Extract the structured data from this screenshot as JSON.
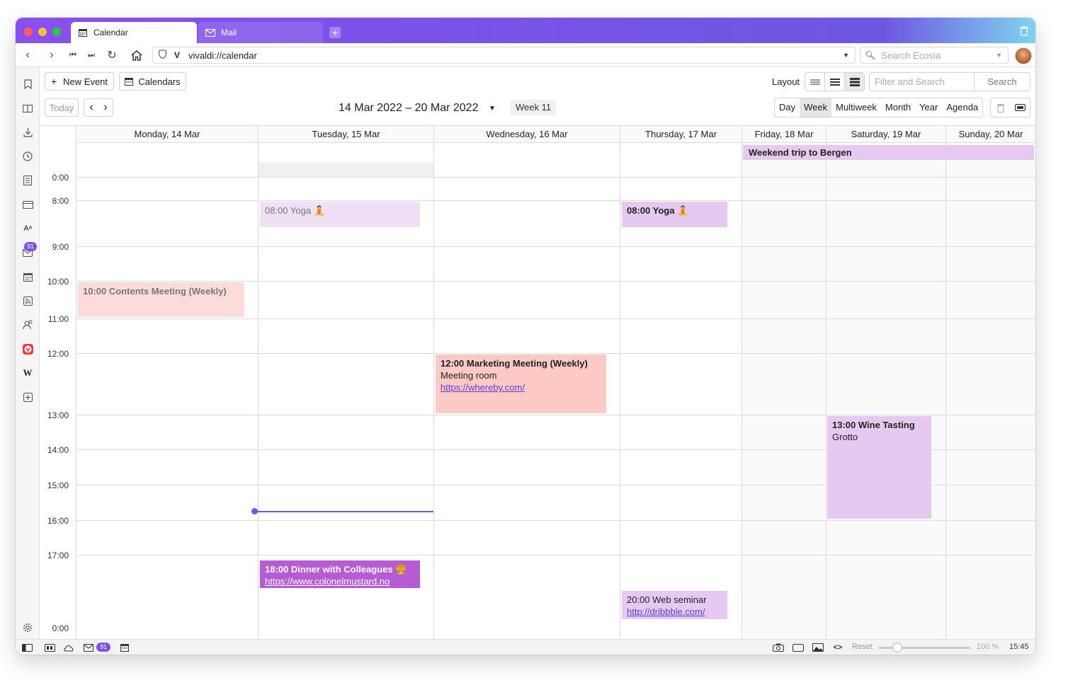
{
  "tabs": [
    {
      "label": "Calendar",
      "icon": "calendar-icon",
      "active": true
    },
    {
      "label": "Mail",
      "icon": "mail-icon",
      "active": false
    }
  ],
  "address": {
    "url": "vivaldi://calendar",
    "search_placeholder": "Search Ecosia"
  },
  "sidebar": {
    "icons": [
      "bookmark-icon",
      "reading-list-icon",
      "downloads-icon",
      "history-icon",
      "notes-icon",
      "window-panel-icon",
      "translate-icon",
      "mail-icon",
      "calendar-icon",
      "feeds-icon",
      "contacts-icon",
      "vivaldi-icon",
      "wikipedia-icon",
      "add-panel-icon",
      "settings-icon"
    ],
    "mail_count": "91"
  },
  "toolbar": {
    "new_event": "New Event",
    "calendars": "Calendars",
    "today": "Today",
    "date_range": "14 Mar 2022 – 20 Mar 2022",
    "week": "Week 11",
    "layout_label": "Layout",
    "filter_placeholder": "Filter and Search",
    "search_button": "Search",
    "views": [
      "Day",
      "Week",
      "Multiweek",
      "Month",
      "Year",
      "Agenda"
    ],
    "selected_view": "Week"
  },
  "days": [
    "Monday, 14 Mar",
    "Tuesday, 15 Mar",
    "Wednesday, 16 Mar",
    "Thursday, 17 Mar",
    "Friday, 18 Mar",
    "Saturday, 19 Mar",
    "Sunday, 20 Mar"
  ],
  "times": [
    "0:00",
    "8:00",
    "9:00",
    "10:00",
    "11:00",
    "12:00",
    "13:00",
    "14:00",
    "15:00",
    "16:00",
    "17:00",
    "0:00"
  ],
  "all_day_event": "Weekend trip to Bergen",
  "events": {
    "yoga_tue": "08:00 Yoga 🧘",
    "yoga_thu": "08:00 Yoga 🧘",
    "contents": "10:00 Contents Meeting (Weekly)",
    "marketing_title": "12:00 Marketing Meeting (Weekly)",
    "marketing_location": "Meeting room",
    "marketing_link": "https://whereby.com/",
    "wine_title": "13:00 Wine Tasting",
    "wine_location": "Grotto",
    "dinner_title": "18:00 Dinner with Colleagues 🍔",
    "dinner_link": "https://www.colonelmustard.no",
    "web_title": "20:00 Web seminar",
    "web_link": "http://dribbble.com/"
  },
  "statusbar": {
    "mail_count": "91",
    "reset": "Reset",
    "zoom": "100 %",
    "zoom_level": 1.0,
    "clock": "15:45"
  },
  "colors": {
    "accent": "#7a52e8",
    "event_pink": "#fcc9c5",
    "event_purple_light": "#e6c9f0",
    "event_purple_dark": "#b65bd4"
  }
}
